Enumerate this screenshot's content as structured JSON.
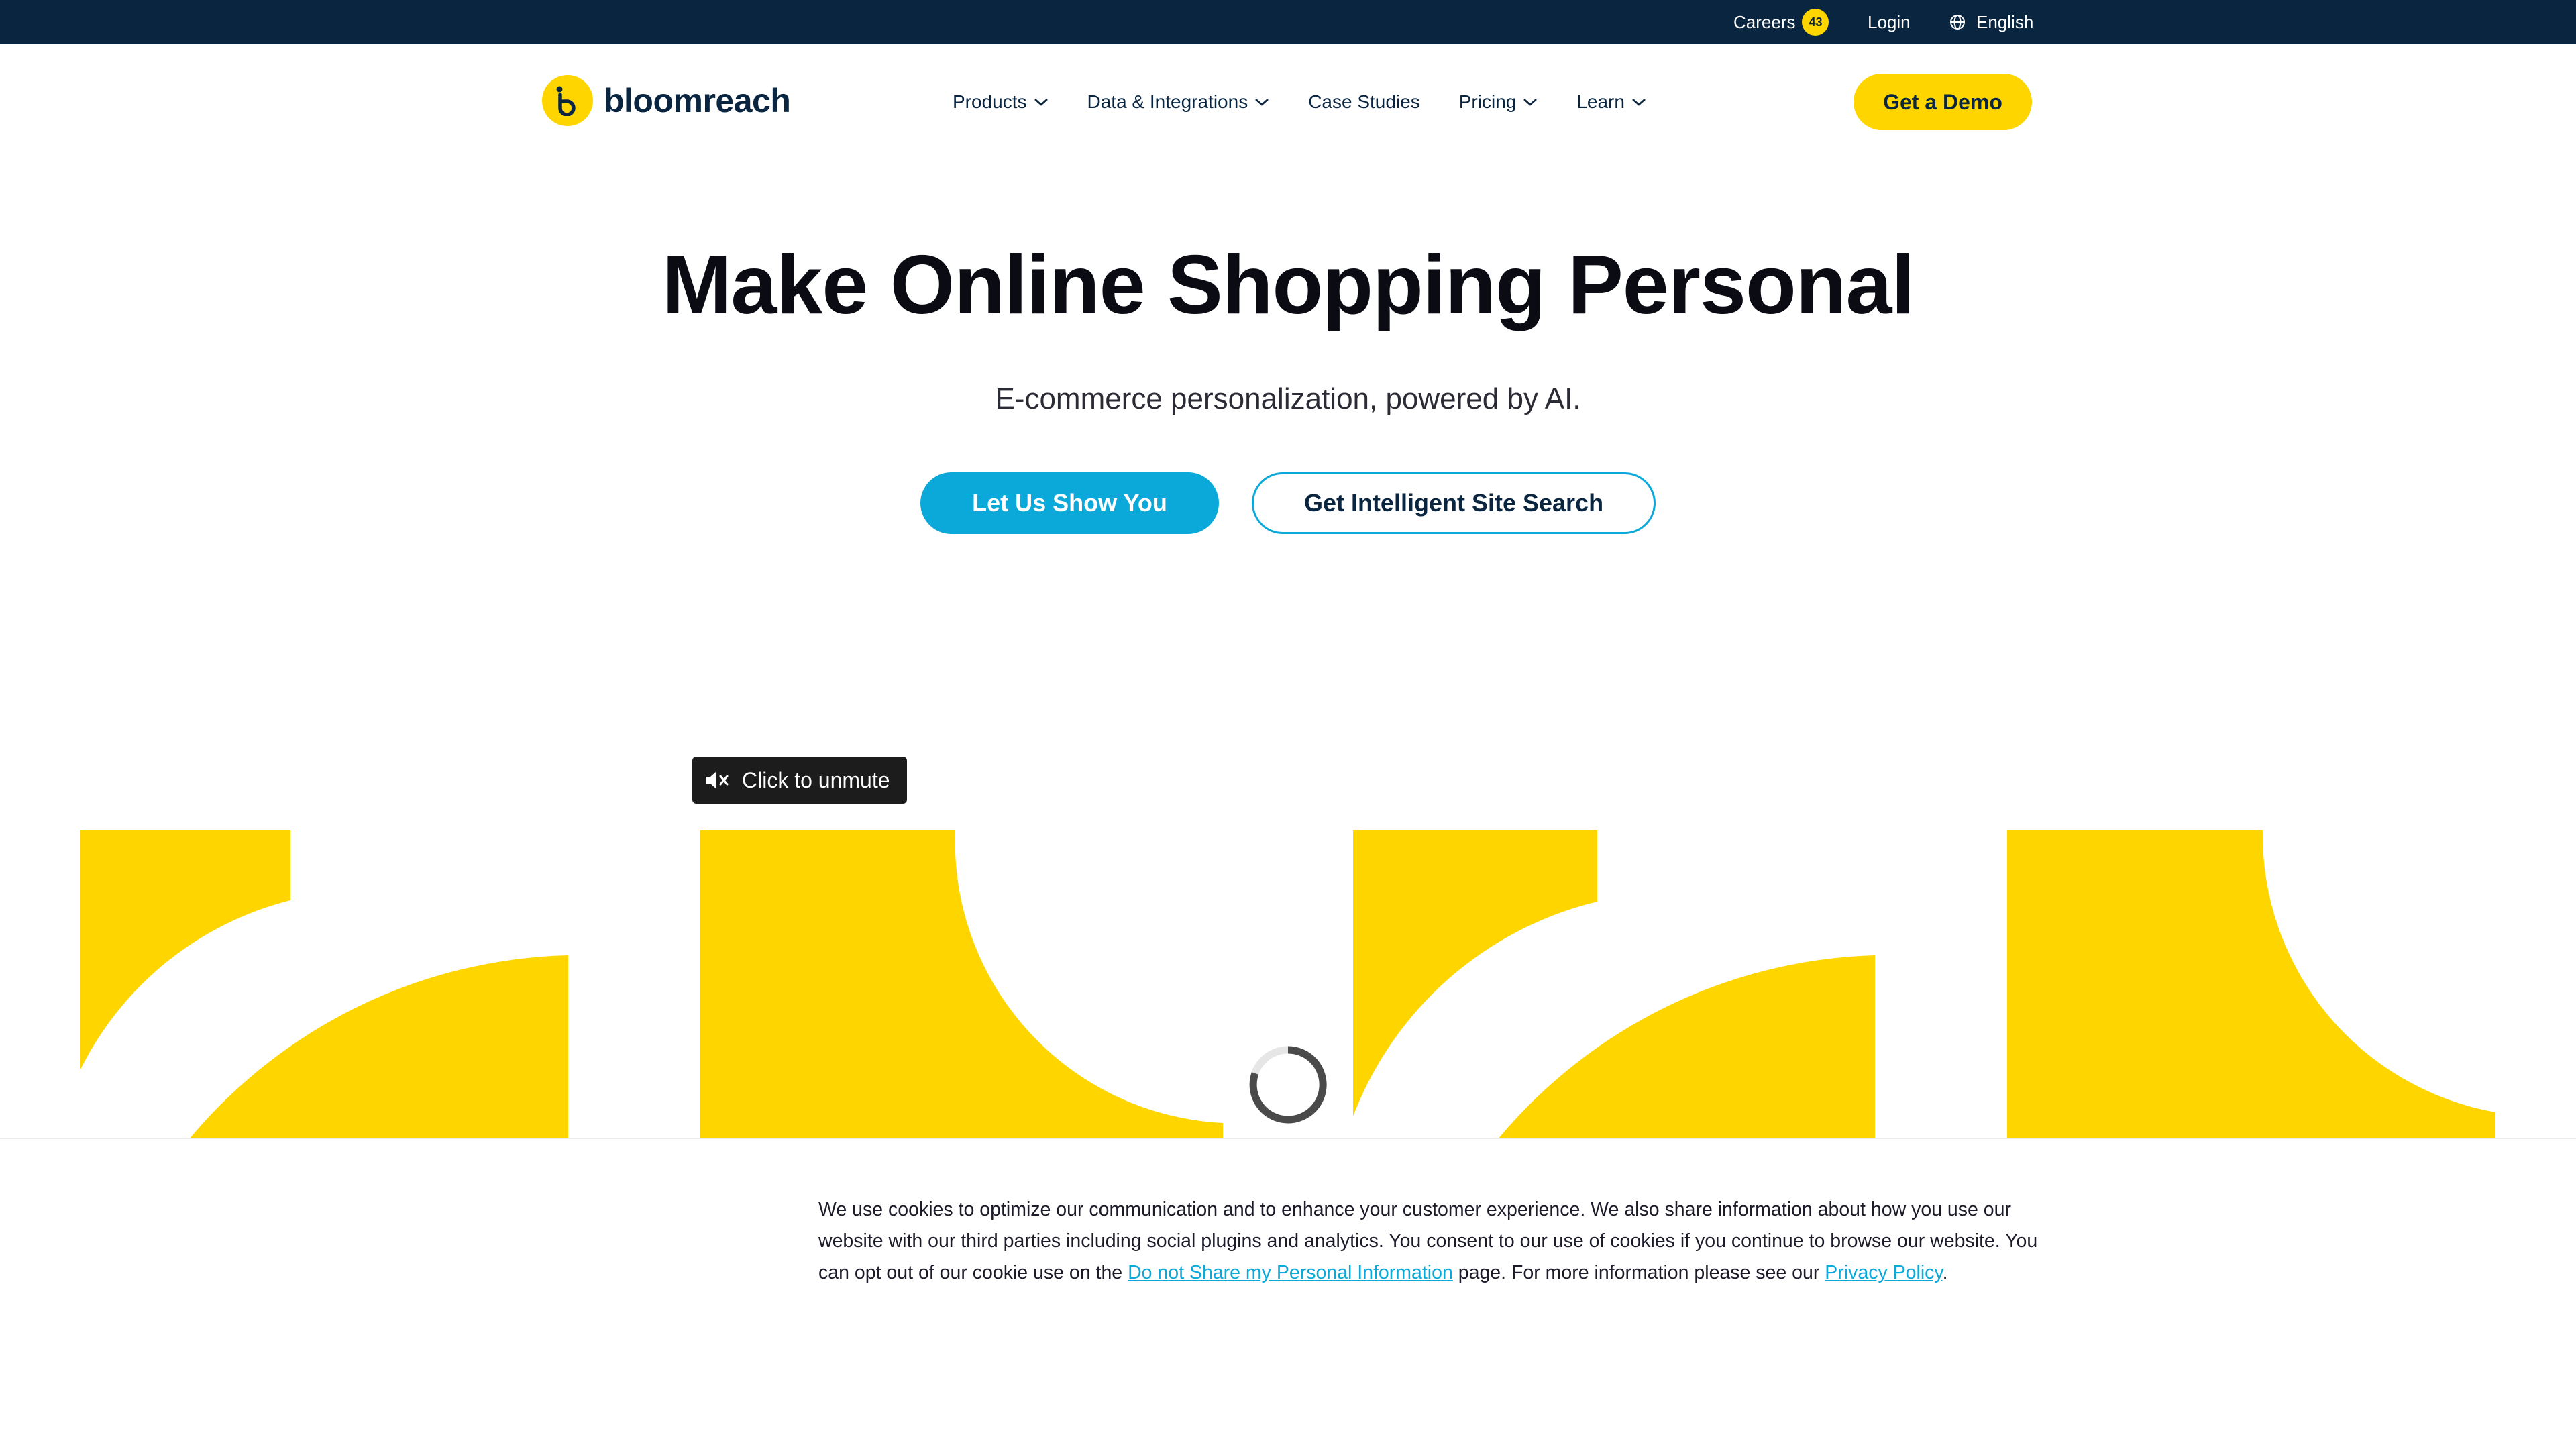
{
  "topbar": {
    "careers_label": "Careers",
    "careers_count": "43",
    "login_label": "Login",
    "language_label": "English"
  },
  "brand": {
    "name": "bloomreach",
    "color": "#ffd500"
  },
  "nav": {
    "items": [
      {
        "label": "Products",
        "has_dropdown": true
      },
      {
        "label": "Data & Integrations",
        "has_dropdown": true
      },
      {
        "label": "Case Studies",
        "has_dropdown": false
      },
      {
        "label": "Pricing",
        "has_dropdown": true
      },
      {
        "label": "Learn",
        "has_dropdown": true
      }
    ],
    "demo_label": "Get a Demo"
  },
  "hero": {
    "title": "Make Online Shopping Personal",
    "subtitle": "E-commerce personalization, powered by AI.",
    "primary_cta": "Let Us Show You",
    "secondary_cta": "Get Intelligent Site Search"
  },
  "video": {
    "unmute_label": "Click to unmute"
  },
  "cookie": {
    "text_1": "We use cookies to optimize our communication and to enhance your customer experience. We also share information about how you use our website with our third parties including social plugins and analytics. You consent to our use of cookies if you continue to browse our website. You can opt out of our cookie use on the ",
    "link_1": "Do not Share my Personal Information",
    "text_2": " page. For more information please see our ",
    "link_2": "Privacy Policy",
    "text_3": "."
  },
  "colors": {
    "topbar_bg": "#0a2540",
    "accent_yellow": "#ffd500",
    "accent_blue": "#0aa9d9"
  }
}
